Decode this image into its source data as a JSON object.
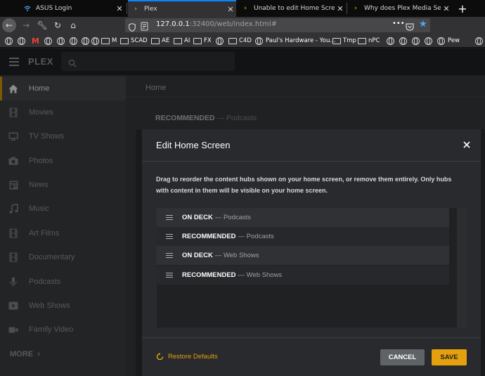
{
  "browser": {
    "tabs": [
      {
        "title": "ASUS Login",
        "icon": "wifi-icon"
      },
      {
        "title": "Plex",
        "icon": "plex-chevron-icon"
      },
      {
        "title": "Unable to edit Home Screen Ite",
        "icon": "plex-chevron-icon"
      },
      {
        "title": "Why does Plex Media Server sa",
        "icon": "plex-chevron-icon"
      }
    ],
    "new_tab": "+",
    "url_host": "127.0.0.1",
    "url_rest": ":32400/web/index.html#",
    "url_more": "•••",
    "bookmarks": [
      "M",
      "SCAD",
      "AE",
      "AI",
      "FX",
      "C4D",
      "Paul's Hardware - You...",
      "Tmp",
      "nPC",
      "Pew"
    ]
  },
  "plex": {
    "logo": "PLEX",
    "accent": "#e5a00d",
    "sidebar": [
      {
        "label": "Home",
        "icon": "home-icon"
      },
      {
        "label": "Movies",
        "icon": "film-icon"
      },
      {
        "label": "TV Shows",
        "icon": "tv-icon"
      },
      {
        "label": "Photos",
        "icon": "camera-icon"
      },
      {
        "label": "News",
        "icon": "news-icon"
      },
      {
        "label": "Music",
        "icon": "music-icon"
      },
      {
        "label": "Art Films",
        "icon": "film-icon"
      },
      {
        "label": "Documentary",
        "icon": "film-icon"
      },
      {
        "label": "Podcasts",
        "icon": "microphone-icon"
      },
      {
        "label": "Web Shows",
        "icon": "play-icon"
      },
      {
        "label": "Family Video",
        "icon": "video-camera-icon"
      }
    ],
    "more": "MORE",
    "main_title": "Home",
    "hub_heading_bold": "RECOMMENDED",
    "hub_heading_rest": " — Podcasts"
  },
  "modal": {
    "title": "Edit Home Screen",
    "description": "Drag to reorder the content hubs shown on your home screen, or remove them entirely. Only hubs with content in them will be visible on your home screen.",
    "hubs": [
      {
        "name": "ON DECK",
        "sub": "— Podcasts"
      },
      {
        "name": "RECOMMENDED",
        "sub": "— Podcasts"
      },
      {
        "name": "ON DECK",
        "sub": "— Web Shows"
      },
      {
        "name": "RECOMMENDED",
        "sub": "— Web Shows"
      }
    ],
    "restore": "Restore Defaults",
    "cancel": "CANCEL",
    "save": "SAVE"
  }
}
